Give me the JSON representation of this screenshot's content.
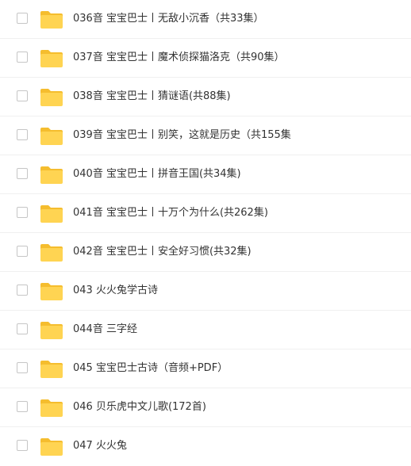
{
  "file_list": {
    "items": [
      {
        "name": "036音 宝宝巴士丨无敌小沉香（共33集）"
      },
      {
        "name": "037音 宝宝巴士丨魔术侦探猫洛克（共90集）"
      },
      {
        "name": "038音 宝宝巴士丨猜谜语(共88集)"
      },
      {
        "name": "039音 宝宝巴士丨别笑，这就是历史（共155集"
      },
      {
        "name": "040音 宝宝巴士丨拼音王国(共34集)"
      },
      {
        "name": "041音 宝宝巴士丨十万个为什么(共262集)"
      },
      {
        "name": "042音 宝宝巴士丨安全好习惯(共32集)"
      },
      {
        "name": "043 火火兔学古诗"
      },
      {
        "name": "044音 三字经"
      },
      {
        "name": "045 宝宝巴士古诗（音频+PDF）"
      },
      {
        "name": "046 贝乐虎中文儿歌(172首)"
      },
      {
        "name": "047 火火兔"
      }
    ],
    "icon": "folder-icon",
    "colors": {
      "folder_body": "#FFD452",
      "folder_tab": "#F5BD2E",
      "text": "#333333",
      "divider": "#F0F0F0",
      "checkbox_border": "#C6C6C6"
    }
  }
}
